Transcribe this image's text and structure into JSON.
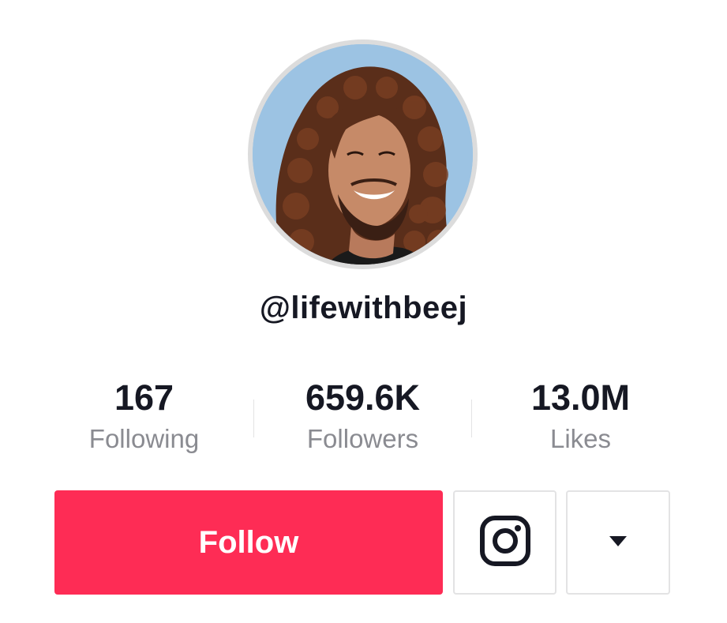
{
  "profile": {
    "username": "@lifewithbeej",
    "avatar_icon": "profile-photo"
  },
  "stats": {
    "following": {
      "value": "167",
      "label": "Following"
    },
    "followers": {
      "value": "659.6K",
      "label": "Followers"
    },
    "likes": {
      "value": "13.0M",
      "label": "Likes"
    }
  },
  "actions": {
    "follow_label": "Follow",
    "instagram_icon": "instagram-icon",
    "more_icon": "caret-down-icon"
  },
  "colors": {
    "accent": "#fe2c55",
    "text_primary": "#161823",
    "text_secondary": "#8a8b91",
    "border": "#e3e3e4"
  }
}
